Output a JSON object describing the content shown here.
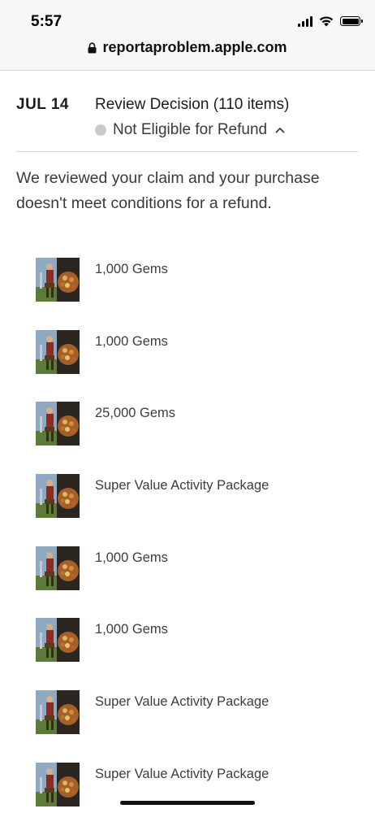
{
  "status_bar": {
    "time": "5:57"
  },
  "browser": {
    "url": "reportaproblem.apple.com"
  },
  "decision": {
    "date": "JUL 14",
    "title": "Review Decision (110 items)",
    "status": "Not Eligible for Refund",
    "status_color": "#c9c9cc",
    "message": "We reviewed your claim and your purchase doesn't meet conditions for a refund."
  },
  "items": [
    {
      "name": "1,000 Gems",
      "icon": "game-art-thumbnail"
    },
    {
      "name": "1,000 Gems",
      "icon": "game-art-thumbnail"
    },
    {
      "name": "25,000 Gems",
      "icon": "game-art-thumbnail"
    },
    {
      "name": "Super Value Activity Package",
      "icon": "game-art-thumbnail"
    },
    {
      "name": "1,000 Gems",
      "icon": "game-art-thumbnail"
    },
    {
      "name": "1,000 Gems",
      "icon": "game-art-thumbnail"
    },
    {
      "name": "Super Value Activity Package",
      "icon": "game-art-thumbnail"
    },
    {
      "name": "Super Value Activity Package",
      "icon": "game-art-thumbnail"
    }
  ]
}
